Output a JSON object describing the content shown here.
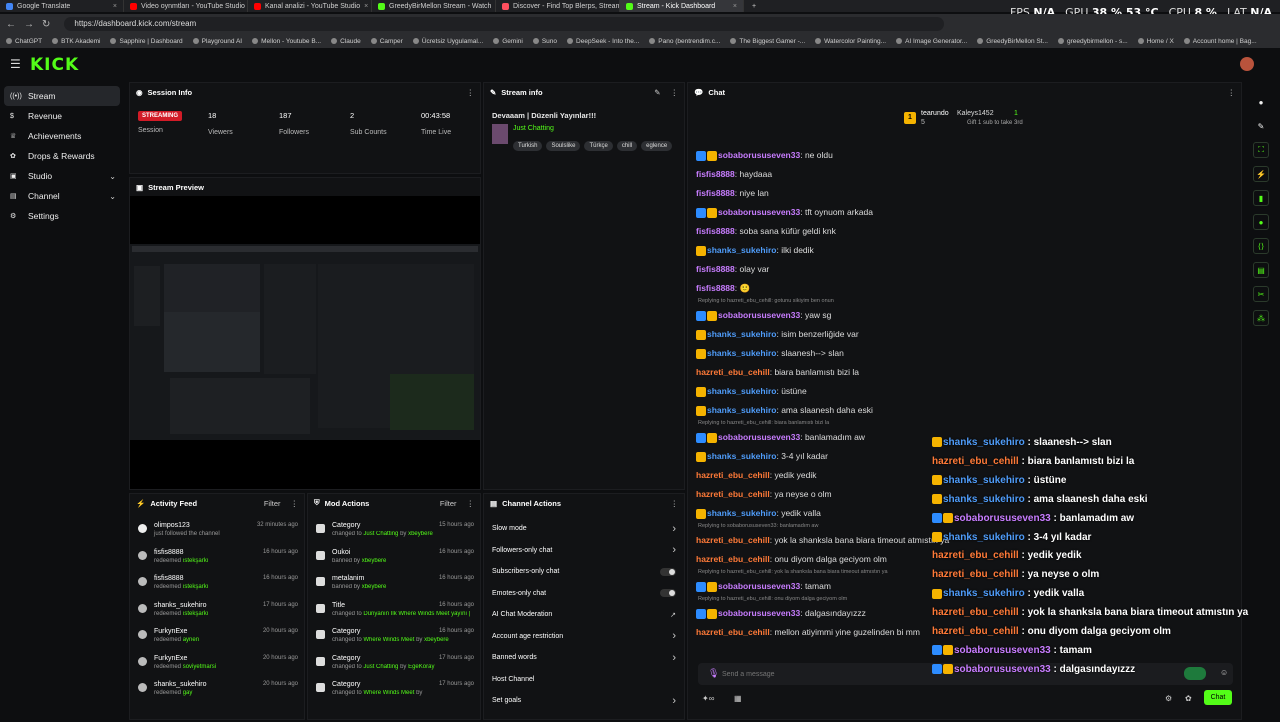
{
  "browser": {
    "tabs": [
      {
        "title": "Google Translate",
        "color": "#4285f4"
      },
      {
        "title": "Video oynmtları - YouTube Studio",
        "color": "#ff0000"
      },
      {
        "title": "Kanal analizi - YouTube Studio",
        "color": "#ff0000"
      },
      {
        "title": "GreedyBirMellon Stream - Watch",
        "color": "#53fc18"
      },
      {
        "title": "Discover - Find Top Blerps, Stream",
        "color": "#ff4f5e"
      },
      {
        "title": "Stream - Kick Dashboard",
        "color": "#53fc18"
      }
    ],
    "url": "https://dashboard.kick.com/stream",
    "bookmarks": [
      "ChatGPT",
      "BTK Akademi",
      "Sapphire | Dashboard",
      "Playground AI",
      "Mellon - Youtube B...",
      "Claude",
      "Camper",
      "Ücretsiz Uygulamal...",
      "Gemini",
      "Suno",
      "DeepSeek - Into the...",
      "Pano (bentrendim.c...",
      "The Biggest Gamer -...",
      "Watercolor Painting...",
      "AI Image Generator...",
      "GreedyBirMellon St...",
      "greedybirmellon - s...",
      "Home / X",
      "Account home | Bag..."
    ]
  },
  "hud": {
    "fps_label": "FPS",
    "fps": "N/A",
    "gpu_label": "GPU",
    "gpu": "38 % 53 °C",
    "cpu_label": "CPU",
    "cpu": "8 %",
    "lat_label": "LAT",
    "lat": "N/A"
  },
  "app": {
    "logo": "KICK"
  },
  "sidebar": {
    "items": [
      {
        "label": "Stream",
        "icon": "broadcast-icon"
      },
      {
        "label": "Revenue",
        "icon": "dollar-icon"
      },
      {
        "label": "Achievements",
        "icon": "trophy-icon"
      },
      {
        "label": "Drops & Rewards",
        "icon": "gift-icon"
      },
      {
        "label": "Studio",
        "icon": "studio-icon"
      },
      {
        "label": "Channel",
        "icon": "channel-icon"
      },
      {
        "label": "Settings",
        "icon": "gear-icon"
      }
    ]
  },
  "session": {
    "title": "Session Info",
    "badge": "STREAMING",
    "badge_label": "Session",
    "stats": [
      {
        "value": "18",
        "label": "Viewers"
      },
      {
        "value": "187",
        "label": "Followers"
      },
      {
        "value": "2",
        "label": "Sub Counts"
      },
      {
        "value": "00:43:58",
        "label": "Time Live"
      }
    ]
  },
  "stream_info": {
    "title": "Stream info",
    "stream_title": "Devaaam | Düzenli Yayınlar!!!",
    "category": "Just Chatting",
    "tags": [
      "Turkish",
      "Soulslike",
      "Türkçe",
      "chill",
      "eglence"
    ]
  },
  "preview": {
    "title": "Stream Preview"
  },
  "activity": {
    "title": "Activity Feed",
    "filter": "Filter",
    "items": [
      {
        "user": "olimpos123",
        "action": "just followed the channel",
        "reward": "",
        "time": "32 minutes ago"
      },
      {
        "user": "fisfis8888",
        "action": "redeemed",
        "reward": "ıstekşarkı",
        "time": "16 hours ago"
      },
      {
        "user": "fisfis8888",
        "action": "redeemed",
        "reward": "ıstekşarkı",
        "time": "16 hours ago"
      },
      {
        "user": "shanks_sukehiro",
        "action": "redeemed",
        "reward": "ıstekşarkı",
        "time": "17 hours ago"
      },
      {
        "user": "FurkynExe",
        "action": "redeemed",
        "reward": "aynen",
        "time": "20 hours ago"
      },
      {
        "user": "FurkynExe",
        "action": "redeemed",
        "reward": "soviyetmarsi",
        "time": "20 hours ago"
      },
      {
        "user": "shanks_sukehiro",
        "action": "redeemed",
        "reward": "gay",
        "time": "20 hours ago"
      }
    ]
  },
  "mod_actions": {
    "title": "Mod Actions",
    "filter": "Filter",
    "items": [
      {
        "head": "Category",
        "pre": "changed to",
        "target": "Just Chatting",
        "by": "by",
        "mod": "xbeybere",
        "time": "15 hours ago"
      },
      {
        "head": "Oukoi",
        "pre": "banned by",
        "target": "",
        "by": "",
        "mod": "xbeybere",
        "time": "16 hours ago"
      },
      {
        "head": "metalanim",
        "pre": "banned by",
        "target": "",
        "by": "",
        "mod": "xbeybere",
        "time": "16 hours ago"
      },
      {
        "head": "Title",
        "pre": "changed to",
        "target": "Dünyanın İlk Where Winds Meet yayını | Düzenli Yayınlar!!!",
        "by": "by",
        "mod": "xbeybere",
        "time": "16 hours ago"
      },
      {
        "head": "Category",
        "pre": "changed to",
        "target": "Where Winds Meet",
        "by": "by",
        "mod": "xbeybere",
        "time": "16 hours ago"
      },
      {
        "head": "Category",
        "pre": "changed to",
        "target": "Just Chatting",
        "by": "by",
        "mod": "EgeKoray",
        "time": "17 hours ago"
      },
      {
        "head": "Category",
        "pre": "changed to",
        "target": "Where Winds Meet",
        "by": "by",
        "mod": "",
        "time": "17 hours ago"
      }
    ]
  },
  "channel_actions": {
    "title": "Channel Actions",
    "items": [
      {
        "label": "Slow mode",
        "type": "arrow"
      },
      {
        "label": "Followers-only chat",
        "type": "arrow"
      },
      {
        "label": "Subscribers-only chat",
        "type": "toggle"
      },
      {
        "label": "Emotes-only chat",
        "type": "toggle"
      },
      {
        "label": "AI Chat Moderation",
        "type": "link"
      },
      {
        "label": "Account age restriction",
        "type": "arrow"
      },
      {
        "label": "Banned words",
        "type": "arrow"
      },
      {
        "label": "Host Channel",
        "type": "none"
      },
      {
        "label": "Set goals",
        "type": "arrow"
      }
    ]
  },
  "chat": {
    "title": "Chat",
    "pinned": {
      "rank": "1",
      "user": "tearundo",
      "count": "5",
      "user2": "Kaleys1452",
      "count2": "1",
      "note": "Gift 1 sub to take 3rd"
    },
    "messages": [
      {
        "user": "sobaborususeven33",
        "color": "purple",
        "badges": 2,
        "text": "ne oldu",
        "reply": ""
      },
      {
        "user": "fisfis8888",
        "color": "purple",
        "badges": 0,
        "text": "haydaaa",
        "reply": ""
      },
      {
        "user": "fisfis8888",
        "color": "purple",
        "badges": 0,
        "text": "niye lan",
        "reply": ""
      },
      {
        "user": "sobaborususeven33",
        "color": "purple",
        "badges": 2,
        "text": "tft oynuom arkada",
        "reply": ""
      },
      {
        "user": "fisfis8888",
        "color": "purple",
        "badges": 0,
        "text": "soba sana küfür geldi knk",
        "reply": ""
      },
      {
        "user": "shanks_sukehiro",
        "color": "blue",
        "badges": 1,
        "text": "ilki dedik",
        "reply": ""
      },
      {
        "user": "fisfis8888",
        "color": "purple",
        "badges": 0,
        "text": "olay var",
        "reply": ""
      },
      {
        "user": "fisfis8888",
        "color": "purple",
        "badges": 0,
        "text": "🙂",
        "reply": ""
      },
      {
        "user": "sobaborususeven33",
        "color": "purple",
        "badges": 2,
        "text": "yaw sg",
        "reply": "Replying to hazreti_ebu_cehill: gotunu sikiyim ben onun"
      },
      {
        "user": "shanks_sukehiro",
        "color": "blue",
        "badges": 1,
        "text": "isim benzerliğide var",
        "reply": ""
      },
      {
        "user": "shanks_sukehiro",
        "color": "blue",
        "badges": 1,
        "text": "slaanesh--> slan",
        "reply": ""
      },
      {
        "user": "hazreti_ebu_cehill",
        "color": "orange",
        "badges": 0,
        "text": "biara banlamıstı bizi la",
        "reply": ""
      },
      {
        "user": "shanks_sukehiro",
        "color": "blue",
        "badges": 1,
        "text": "üstüne",
        "reply": ""
      },
      {
        "user": "shanks_sukehiro",
        "color": "blue",
        "badges": 1,
        "text": "ama slaanesh daha eski",
        "reply": ""
      },
      {
        "user": "sobaborususeven33",
        "color": "purple",
        "badges": 2,
        "text": "banlamadım aw",
        "reply": "Replying to hazreti_ebu_cehill: biara banlamıstı bizi la"
      },
      {
        "user": "shanks_sukehiro",
        "color": "blue",
        "badges": 1,
        "text": "3-4 yıl kadar",
        "reply": ""
      },
      {
        "user": "hazreti_ebu_cehill",
        "color": "orange",
        "badges": 0,
        "text": "yedik yedik",
        "reply": ""
      },
      {
        "user": "hazreti_ebu_cehill",
        "color": "orange",
        "badges": 0,
        "text": "ya neyse o olm",
        "reply": ""
      },
      {
        "user": "shanks_sukehiro",
        "color": "blue",
        "badges": 1,
        "text": "yedik valla",
        "reply": ""
      },
      {
        "user": "hazreti_ebu_cehill",
        "color": "orange",
        "badges": 0,
        "text": "yok la shanksla bana biara timeout atmıstın ya",
        "reply": "Replying to sobaborususeven33: banlamadım aw"
      },
      {
        "user": "hazreti_ebu_cehill",
        "color": "orange",
        "badges": 0,
        "text": "onu diyom dalga geciyom olm",
        "reply": ""
      },
      {
        "user": "sobaborususeven33",
        "color": "purple",
        "badges": 2,
        "text": "tamam",
        "reply": "Replying to hazreti_ebu_cehill: yok la shanksla bana biara timeout atmıstın ya"
      },
      {
        "user": "sobaborususeven33",
        "color": "purple",
        "badges": 2,
        "text": "dalgasındayızzz",
        "reply": "Replying to hazreti_ebu_cehill: onu diyom dalga geciyom olm"
      },
      {
        "user": "hazreti_ebu_cehill",
        "color": "orange",
        "badges": 0,
        "text": "mellon atiyimmi yine guzelinden bi mm",
        "reply": ""
      }
    ],
    "placeholder": "Send a message",
    "send": "Chat"
  },
  "overlay_chat": [
    {
      "user": "shanks_sukehiro",
      "color": "blue",
      "badges": 1,
      "text": "slaanesh--> slan"
    },
    {
      "user": "hazreti_ebu_cehill",
      "color": "orange",
      "badges": 0,
      "text": "biara banlamıstı bizi la"
    },
    {
      "user": "shanks_sukehiro",
      "color": "blue",
      "badges": 1,
      "text": "üstüne"
    },
    {
      "user": "shanks_sukehiro",
      "color": "blue",
      "badges": 1,
      "text": "ama slaanesh daha eski"
    },
    {
      "user": "sobaborususeven33",
      "color": "purple",
      "badges": 2,
      "text": "banlamadım aw"
    },
    {
      "user": "shanks_sukehiro",
      "color": "blue",
      "badges": 1,
      "text": "3-4 yıl kadar"
    },
    {
      "user": "hazreti_ebu_cehill",
      "color": "orange",
      "badges": 0,
      "text": "yedik yedik"
    },
    {
      "user": "hazreti_ebu_cehill",
      "color": "orange",
      "badges": 0,
      "text": "ya neyse o olm"
    },
    {
      "user": "shanks_sukehiro",
      "color": "blue",
      "badges": 1,
      "text": "yedik valla"
    },
    {
      "user": "hazreti_ebu_cehill",
      "color": "orange",
      "badges": 0,
      "text": "yok la shanksla bana biara timeout atmıstın ya"
    },
    {
      "user": "hazreti_ebu_cehill",
      "color": "orange",
      "badges": 0,
      "text": "onu diyom dalga geciyom olm"
    },
    {
      "user": "sobaborususeven33",
      "color": "purple",
      "badges": 2,
      "text": "tamam"
    },
    {
      "user": "sobaborususeven33",
      "color": "purple",
      "badges": 2,
      "text": "dalgasındayızzz"
    }
  ],
  "colors": {
    "accent": "#53fc18",
    "live": "#d21b27",
    "purple": "#c87dff",
    "blue": "#4f9cf9",
    "orange": "#ff7a38"
  }
}
